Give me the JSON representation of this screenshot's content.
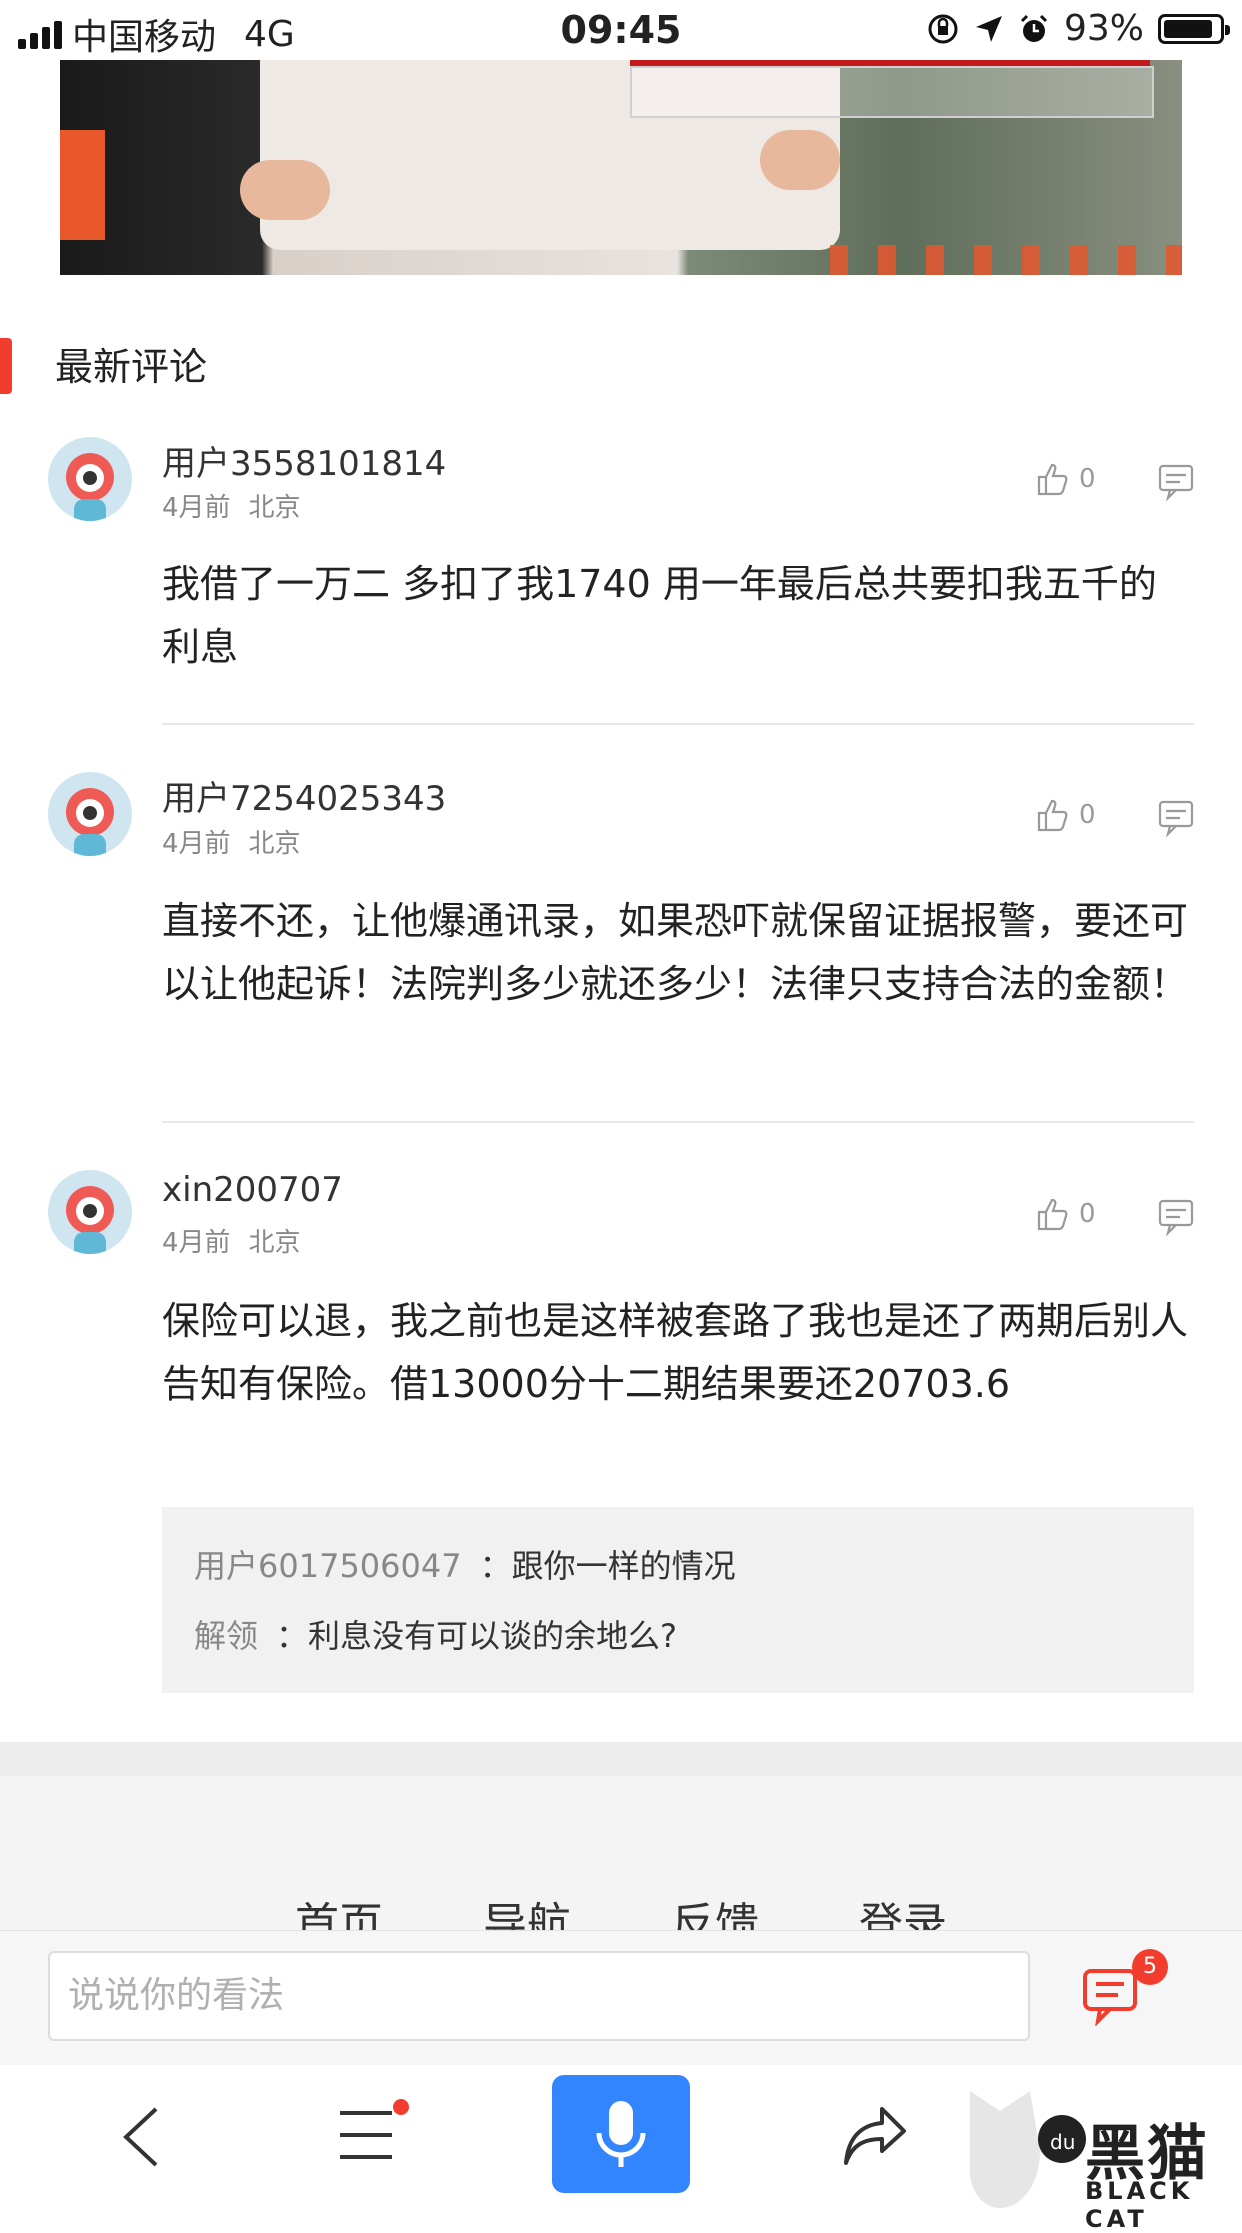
{
  "status_bar": {
    "carrier": "中国移动",
    "network": "4G",
    "time": "09:45",
    "battery": "93%"
  },
  "section": {
    "title": "最新评论"
  },
  "comments": [
    {
      "user": "用户3558101814",
      "time": "4月前",
      "location": "北京",
      "likes": "0",
      "text": "我借了一万二 多扣了我1740 用一年最后总共要扣我五千的利息"
    },
    {
      "user": "用户7254025343",
      "time": "4月前",
      "location": "北京",
      "likes": "0",
      "text": "直接不还，让他爆通讯录，如果恐吓就保留证据报警，要还可以让他起诉！法院判多少就还多少！法律只支持合法的金额！"
    },
    {
      "user": "xin200707",
      "time": "4月前",
      "location": "北京",
      "likes": "0",
      "text": "保险可以退，我之前也是这样被套路了我也是还了两期后别人告知有保险。借13000分十二期结果要还20703.6",
      "replies": [
        {
          "user": "用户6017506047",
          "text": "：跟你一样的情况"
        },
        {
          "user": "解领",
          "text": "：利息没有可以谈的余地么?"
        }
      ]
    }
  ],
  "footer": {
    "links": [
      "首页",
      "导航",
      "反馈",
      "登录"
    ]
  },
  "input_bar": {
    "placeholder": "说说你的看法",
    "comment_count": "5"
  },
  "watermark": {
    "text": "黑猫",
    "sub": "BLACK CAT"
  },
  "colors": {
    "accent": "#f23d2e",
    "mic_button": "#3385ff"
  }
}
